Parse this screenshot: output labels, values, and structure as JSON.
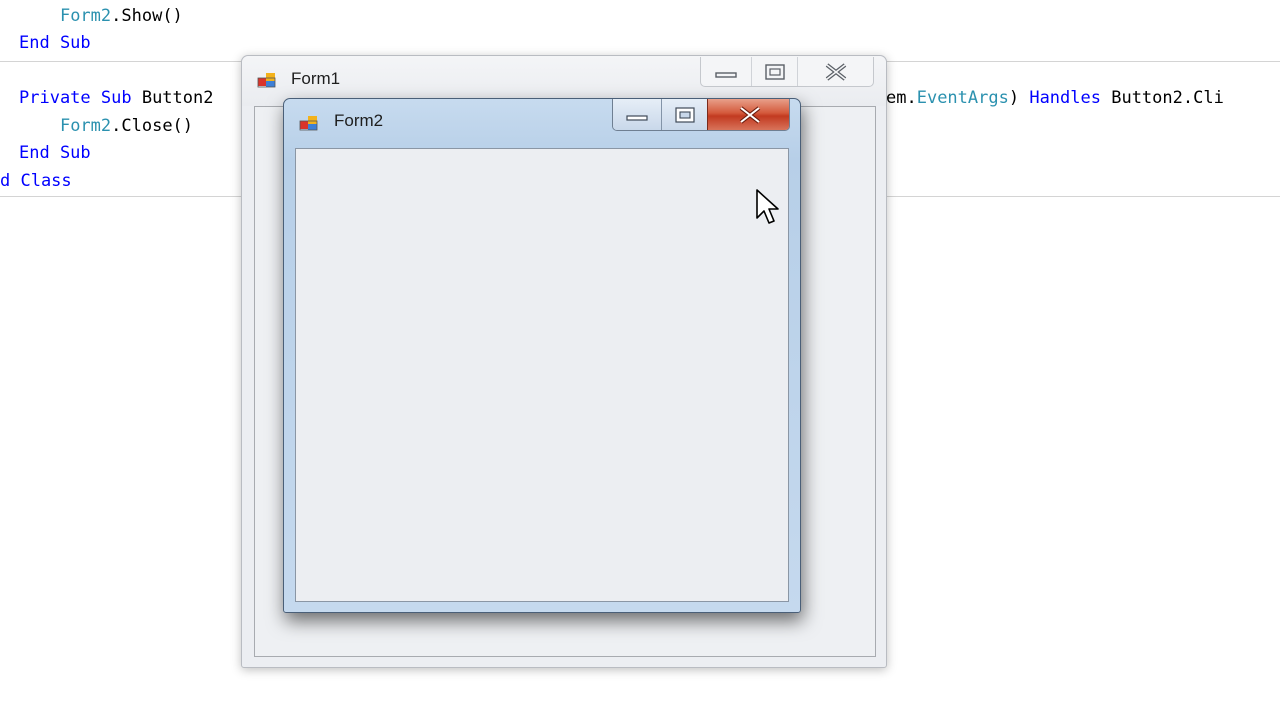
{
  "editor": {
    "lines": [
      {
        "tokens": [
          {
            "t": "    "
          },
          {
            "t": "Form2",
            "c": "ty"
          },
          {
            "t": ".Show()"
          }
        ]
      },
      {
        "tokens": [
          {
            "t": "End Sub",
            "c": "kw"
          }
        ]
      },
      {
        "tokens": [
          {
            "t": "Private Sub",
            "c": "kw"
          },
          {
            "t": " Button2"
          }
        ]
      },
      {
        "tokens": [
          {
            "t": "    "
          },
          {
            "t": "Form2",
            "c": "ty"
          },
          {
            "t": ".Close()"
          }
        ]
      },
      {
        "tokens": [
          {
            "t": "End Sub",
            "c": "kw"
          }
        ]
      },
      {
        "tokens": [
          {
            "t": "d Class",
            "c": "kw"
          }
        ]
      },
      {
        "tokens": [
          {
            "t": "em."
          },
          {
            "t": "EventArgs",
            "c": "ty"
          },
          {
            "t": ") "
          },
          {
            "t": "Handles",
            "c": "kw"
          },
          {
            "t": " Button2.Cli"
          }
        ]
      }
    ]
  },
  "form1": {
    "title": "Form1",
    "buttons": {
      "minimize": "minimize",
      "maximize": "maximize",
      "close": "close"
    },
    "icon": "app-window-icon"
  },
  "form2": {
    "title": "Form2",
    "buttons": {
      "minimize": "minimize",
      "maximize": "maximize",
      "close": "close"
    },
    "icon": "app-window-icon",
    "close_color": "#c9462c"
  },
  "cursor": "arrow-cursor-icon"
}
